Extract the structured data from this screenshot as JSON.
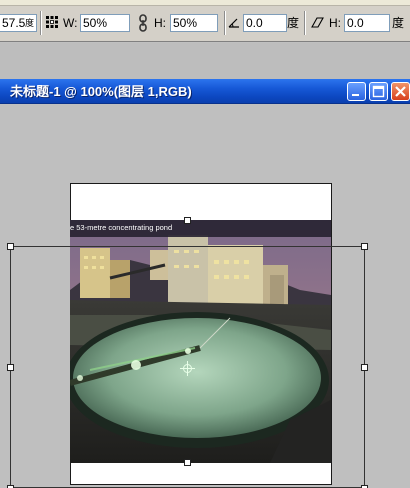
{
  "options_bar": {
    "angle_value": "57.5",
    "angle_unit_glyph": "度",
    "width_label": "W:",
    "width_value": "50%",
    "height_label": "H:",
    "height_value": "50%",
    "rotation_value": "0.0",
    "rotation_unit": "度",
    "skew_h_label": "H:",
    "skew_h_value": "0.0",
    "skew_unit": "度",
    "icons": [
      "reference-point-icon",
      "link-chain-icon",
      "angle-icon",
      "skew-icon"
    ]
  },
  "document_window": {
    "title": "未标题-1 @ 100%(图层 1,RGB)",
    "buttons": [
      "minimize-icon",
      "maximize-icon",
      "close-icon"
    ]
  },
  "image": {
    "caption": "e 53-metre concentrating pond"
  },
  "colors": {
    "title_bar": "#0c47c0",
    "canvas_gray": "#bfbfbf",
    "toolbar_gray": "#d4d0c8",
    "close_button": "#d8401c"
  }
}
